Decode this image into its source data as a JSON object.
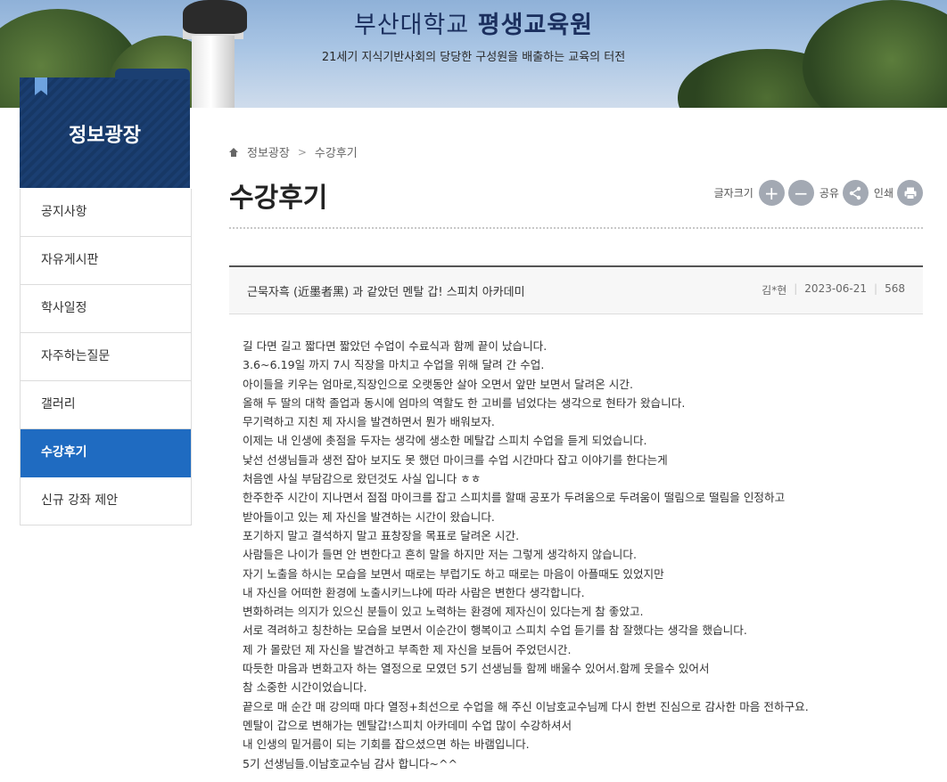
{
  "banner": {
    "title_light": "부산대학교",
    "title_bold": "평생교육원",
    "subtitle": "21세기 지식기반사회의 당당한 구성원을 배출하는 교육의 터전"
  },
  "sidebar": {
    "title": "정보광장",
    "items": [
      {
        "label": "공지사항"
      },
      {
        "label": "자유게시판"
      },
      {
        "label": "학사일정"
      },
      {
        "label": "자주하는질문"
      },
      {
        "label": "갤러리"
      },
      {
        "label": "수강후기"
      },
      {
        "label": "신규 강좌 제안"
      }
    ],
    "active_index": 5
  },
  "breadcrumb": {
    "items": [
      "정보광장",
      "수강후기"
    ],
    "icon": "home-icon"
  },
  "page_title": "수강후기",
  "tools": {
    "font_size_label": "글자크기",
    "plus_symbol": "+",
    "minus_symbol": "−",
    "share_label": "공유",
    "print_label": "인쇄"
  },
  "post": {
    "title": "근묵자흑 (近墨者黑) 과 같았던 멘탈 갑! 스피치 아카데미",
    "author": "김*현",
    "date": "2023-06-21",
    "views": "568",
    "lines": [
      "길 다면 길고 짧다면 짧았던 수업이 수료식과 함께 끝이 났습니다.",
      "3.6~6.19일 까지 7시 직장을 마치고 수업을 위해 달려 간 수업.",
      "아이들을 키우는 엄마로,직장인으로 오랫동안 살아 오면서 앞만 보면서 달려온 시간.",
      "올해 두 딸의 대학 졸업과 동시에 엄마의 역할도 한 고비를 넘었다는 생각으로 현타가 왔습니다.",
      "무기력하고 지친 제 자시을 발견하면서 뭔가 배워보자.",
      "이제는 내 인생에 촛점을 두자는 생각에 생소한 메탈갑 스피치 수업을 듣게 되었습니다.",
      "낯선 선생님들과 생전 잡아 보지도 못 했던 마이크를 수업 시간마다 잡고 이야기를 한다는게",
      "처음엔 사실 부담감으로 왔던것도 사실 입니다 ㅎㅎ",
      "한주한주 시간이 지나면서 점점 마이크를 잡고 스피치를 할때 공포가 두려움으로 두려움이 떨림으로 떨림을 인정하고",
      "받아들이고 있는 제 자신을 발견하는 시간이 왔습니다.",
      "포기하지 말고 결석하지 말고 표창장을 목표로 달려온 시간.",
      "사람들은 나이가 들면 안 변한다고 흔히 말을 하지만 저는 그렇게 생각하지 않습니다.",
      "자기 노출을 하시는 모습을 보면서 때로는 부럽기도 하고 때로는 마음이 아플때도 있었지만",
      "내 자신을 어떠한 환경에 노출시키느냐에 따라 사람은 변한다 생각합니다.",
      "변화하려는 의지가 있으신 분들이 있고 노력하는 환경에 제자신이 있다는게 참 좋았고.",
      "서로 격려하고 칭찬하는 모습을 보면서 이순간이 행복이고 스피치 수업 듣기를 참 잘했다는 생각을 했습니다.",
      "제 가 몰랐던 제 자신을 발견하고 부족한 제 자신을 보듬어 주었던시간.",
      "따듯한 마음과 변화고자 하는 열정으로 모였던 5기 선생님들 함께 배울수 있어서.함께 웃을수 있어서",
      "참 소중한 시간이었습니다.",
      "끝으로 매 순간 매 강의때 마다 열정+최선으로 수업을 해 주신 이남호교수님께 다시 한번 진심으로 감사한 마음 전하구요.",
      "멘탈이 갑으로 변해가는 멘탈갑!스피치 아카데미 수업 많이 수강하셔서",
      "내 인생의 밑거름이 되는 기회를 잡으셨으면 하는 바램입니다.",
      "5기 선생님들.이남호교수님 감사 합니다~^^"
    ]
  },
  "colors": {
    "sidebar_head": "#1b3f72",
    "active_item": "#1f6bc1",
    "tool_button": "#a3a9b3"
  }
}
